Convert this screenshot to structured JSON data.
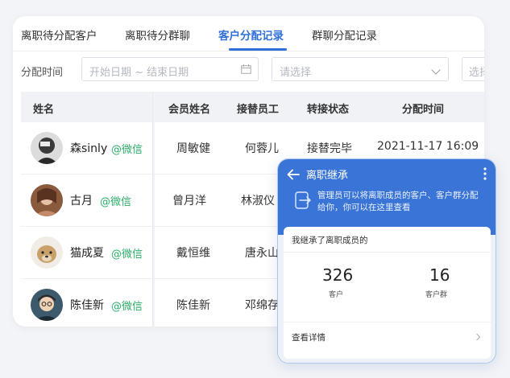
{
  "tabs": [
    {
      "label": "离职待分配客户"
    },
    {
      "label": "离职待分群聊"
    },
    {
      "label": "客户分配记录"
    },
    {
      "label": "群聊分配记录"
    }
  ],
  "filters": {
    "label": "分配时间",
    "date_placeholder": "开始日期 ~ 结束日期",
    "select1_placeholder": "请选择",
    "select2_placeholder": "选择"
  },
  "table": {
    "headers": [
      "姓名",
      "会员姓名",
      "接替员工",
      "转接状态",
      "分配时间"
    ],
    "rows": [
      {
        "name": "森sinly",
        "source": "@微信",
        "member": "周敏健",
        "staff": "何蓉儿",
        "status": "接替完毕",
        "time": "2021-11-17 16:09"
      },
      {
        "name": "古月",
        "source": "@微信",
        "member": "曾月洋",
        "staff": "林淑仪",
        "status": "",
        "time": ""
      },
      {
        "name": "猫成夏",
        "source": "@微信",
        "member": "戴恒维",
        "staff": "唐永山",
        "status": "",
        "time": ""
      },
      {
        "name": "陈佳新",
        "source": "@微信",
        "member": "陈佳新",
        "staff": "邓绵存",
        "status": "",
        "time": ""
      }
    ]
  },
  "phone": {
    "title": "离职继承",
    "info": "管理员可以将离职成员的客户、客户群分配给你，你可以在这里查看",
    "card_title": "我继承了离职成员的",
    "stats": [
      {
        "value": "326",
        "label": "客户"
      },
      {
        "value": "16",
        "label": "客户群"
      }
    ],
    "detail_label": "查看详情"
  },
  "colors": {
    "accent": "#2f6fd8",
    "wechat_green": "#2aae67",
    "phone_header": "#3a74d6"
  }
}
